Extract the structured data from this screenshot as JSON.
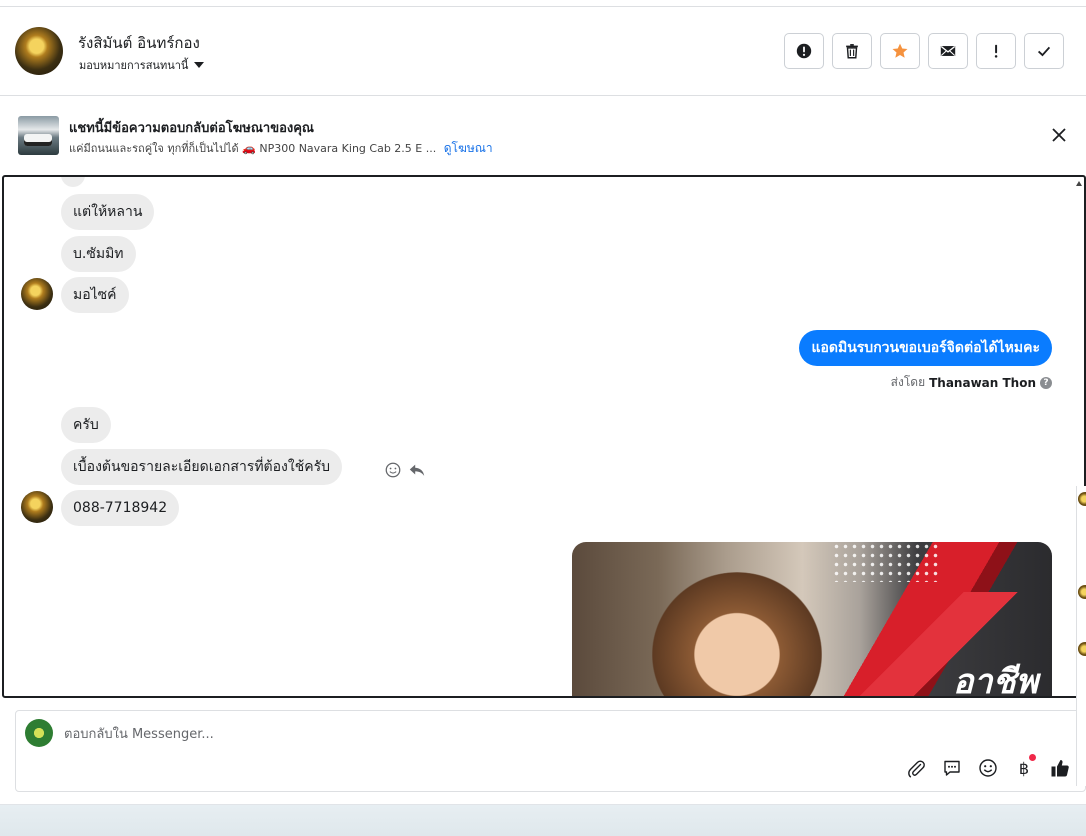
{
  "header": {
    "contact_name": "รังสิมันต์ อินทร์กอง",
    "assign_label": "มอบหมายการสนทนานี้",
    "actions": [
      {
        "name": "report-button",
        "icon": "alert-circle-icon",
        "highlighted": false
      },
      {
        "name": "delete-button",
        "icon": "trash-icon",
        "highlighted": false
      },
      {
        "name": "star-button",
        "icon": "star-icon",
        "highlighted": true
      },
      {
        "name": "mark-unread-button",
        "icon": "envelope-icon",
        "highlighted": false
      },
      {
        "name": "follow-up-button",
        "icon": "exclamation-icon",
        "highlighted": false
      },
      {
        "name": "mark-done-button",
        "icon": "check-icon",
        "highlighted": false
      }
    ]
  },
  "ad_banner": {
    "title": "แชทนี้มีข้อความตอบกลับต่อโฆษณาของคุณ",
    "subtitle": "แค่มีถนนและรถคู่ใจ ทุกที่ก็เป็นไปได้ 🚗 NP300 Navara King Cab 2.5 E ...",
    "link": "ดูโฆษณา"
  },
  "messages": {
    "in_1": "แต่ให้หลาน",
    "in_2": "บ.ซัมมิท",
    "in_3": "มอไซค์",
    "out_1": "แอดมินรบกวนขอเบอร์จิดต่อได้ไหมคะ",
    "sent_by_prefix": "ส่งโดย",
    "sent_by_name": "Thanawan Thon",
    "in_4": "ครับ",
    "in_5": "เบื้องต้นขอรายละเอียดเอกสารที่ต้องใช้ครับ",
    "in_6": "088-7718942",
    "image_caption": "อาชีพ"
  },
  "composer": {
    "placeholder": "ตอบกลับใน Messenger...",
    "tools": [
      "paperclip-icon",
      "saved-reply-icon",
      "emoji-icon",
      "baht-icon",
      "thumbs-up-icon"
    ],
    "baht_symbol": "฿"
  },
  "colors": {
    "outgoing_bubble": "#0a7cff",
    "incoming_bubble": "#ececec",
    "star_accent": "#f5923e",
    "link": "#1a73e8",
    "badge_red": "#f02849"
  }
}
